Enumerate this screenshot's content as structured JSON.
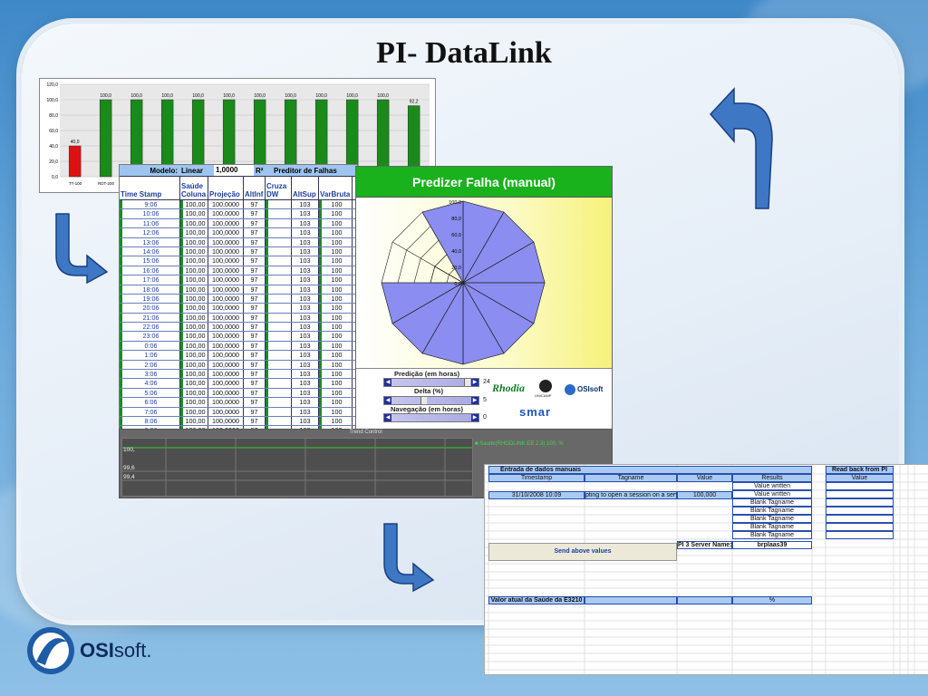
{
  "slide": {
    "title": "PI- DataLink"
  },
  "bar_chart": {
    "y_ticks": [
      "0,0",
      "20,0",
      "40,0",
      "60,0",
      "80,0",
      "100,0",
      "120,0"
    ],
    "bars": [
      {
        "label": "40,0",
        "value": 40,
        "color": "#d11"
      },
      {
        "label": "100,0",
        "value": 100,
        "color": "#1a8a1a"
      },
      {
        "label": "100,0",
        "value": 100,
        "color": "#1a8a1a"
      },
      {
        "label": "100,0",
        "value": 100,
        "color": "#1a8a1a"
      },
      {
        "label": "100,0",
        "value": 100,
        "color": "#1a8a1a"
      },
      {
        "label": "100,0",
        "value": 100,
        "color": "#1a8a1a"
      },
      {
        "label": "100,0",
        "value": 100,
        "color": "#1a8a1a"
      },
      {
        "label": "100,0",
        "value": 100,
        "color": "#1a8a1a"
      },
      {
        "label": "100,0",
        "value": 100,
        "color": "#1a8a1a"
      },
      {
        "label": "100,0",
        "value": 100,
        "color": "#1a8a1a"
      },
      {
        "label": "100,0",
        "value": 100,
        "color": "#1a8a1a"
      },
      {
        "label": "92,2",
        "value": 92.2,
        "color": "#1a8a1a"
      }
    ],
    "categories": [
      "TT-100",
      "RDT-200"
    ]
  },
  "sheet": {
    "model_label": "Modelo:",
    "model_value": "Linear",
    "coef": "1,0000",
    "r2": "R²",
    "title": "Preditor de Falhas",
    "headers": {
      "timestamp": "Time Stamp",
      "saude": "Saúde Coluna",
      "projecao": "Projeção",
      "altinf": "AltInf",
      "cruzadw": "Cruza DW",
      "altsup": "AltSup",
      "varbruta": "VarBruta"
    },
    "rows": [
      [
        "9:06",
        "100,00",
        "100,0000",
        "97",
        "",
        "103",
        "100"
      ],
      [
        "10:06",
        "100,00",
        "100,0000",
        "97",
        "",
        "103",
        "100"
      ],
      [
        "11:06",
        "100,00",
        "100,0000",
        "97",
        "",
        "103",
        "100"
      ],
      [
        "12:06",
        "100,00",
        "100,0000",
        "97",
        "",
        "103",
        "100"
      ],
      [
        "13:06",
        "100,00",
        "100,0000",
        "97",
        "",
        "103",
        "100"
      ],
      [
        "14:06",
        "100,00",
        "100,0000",
        "97",
        "",
        "103",
        "100"
      ],
      [
        "15:06",
        "100,00",
        "100,0000",
        "97",
        "",
        "103",
        "100"
      ],
      [
        "16:06",
        "100,00",
        "100,0000",
        "97",
        "",
        "103",
        "100"
      ],
      [
        "17:06",
        "100,00",
        "100,0000",
        "97",
        "",
        "103",
        "100"
      ],
      [
        "18:06",
        "100,00",
        "100,0000",
        "97",
        "",
        "103",
        "100"
      ],
      [
        "19:06",
        "100,00",
        "100,0000",
        "97",
        "",
        "103",
        "100"
      ],
      [
        "20:06",
        "100,00",
        "100,0000",
        "97",
        "",
        "103",
        "100"
      ],
      [
        "21:06",
        "100,00",
        "100,0000",
        "97",
        "",
        "103",
        "100"
      ],
      [
        "22:06",
        "100,00",
        "100,0000",
        "97",
        "",
        "103",
        "100"
      ],
      [
        "23:06",
        "100,00",
        "100,0000",
        "97",
        "",
        "103",
        "100"
      ],
      [
        "0:06",
        "100,00",
        "100,0000",
        "97",
        "",
        "103",
        "100"
      ],
      [
        "1:06",
        "100,00",
        "100,0000",
        "97",
        "",
        "103",
        "100"
      ],
      [
        "2:06",
        "100,00",
        "100,0000",
        "97",
        "",
        "103",
        "100"
      ],
      [
        "3:06",
        "100,00",
        "100,0000",
        "97",
        "",
        "103",
        "100"
      ],
      [
        "4:06",
        "100,00",
        "100,0000",
        "97",
        "",
        "103",
        "100"
      ],
      [
        "5:06",
        "100,00",
        "100,0000",
        "97",
        "",
        "103",
        "100"
      ],
      [
        "6:06",
        "100,00",
        "100,0000",
        "97",
        "",
        "103",
        "100"
      ],
      [
        "7:06",
        "100,00",
        "100,0000",
        "97",
        "",
        "103",
        "100"
      ],
      [
        "8:06",
        "100,00",
        "100,0000",
        "97",
        "",
        "103",
        "100"
      ],
      [
        "9:06",
        "100,00",
        "100,0000",
        "97",
        "",
        "103",
        "100"
      ],
      [
        "10:06",
        "100,00",
        "100,0000",
        "97",
        "",
        "103",
        "100"
      ],
      [
        "11:06",
        "100,00",
        "100,0000",
        "97",
        "",
        "103",
        "100"
      ]
    ]
  },
  "pie": {
    "title": "Predizer Falha (manual)",
    "ring_labels": [
      "100,0",
      "80,0",
      "60,0",
      "40,0",
      "20,0",
      "0,0"
    ],
    "slices": 12,
    "values": [
      100,
      100,
      100,
      100,
      100,
      100,
      100,
      100,
      100,
      40,
      40,
      100
    ],
    "controls": {
      "predicao_label": "Predição (em horas)",
      "predicao_value": "24",
      "delta_label": "Delta (%)",
      "delta_value": "5",
      "navegacao_label": "Navegação (em horas)",
      "navegacao_value": "0"
    },
    "logos": {
      "rhodia": "Rhodia",
      "smar": "smar",
      "unicamp": "UNICAMP",
      "osisoft": "OSIsoft"
    }
  },
  "trend": {
    "title": "Trend Control",
    "y_labels": [
      "100,",
      "99,6",
      "99,4"
    ],
    "legend": "■ Saude(RHODLINK.EE 2.3) 100, %"
  },
  "entry": {
    "section_title": "Entrada de dados manuais",
    "headers": {
      "timestamp": "Timestamp",
      "tagname": "Tagname",
      "value": "Value",
      "results": "Results"
    },
    "readback_title": "Read back from PI",
    "readback_value_hdr": "Value",
    "row1": {
      "timestamp": "31/10/2008 10:09",
      "tagname": "pting to open a session on a serv",
      "value": "100,000"
    },
    "results": [
      "Value written",
      "Value written",
      "Blank Tagname",
      "Blank Tagname",
      "Blank Tagname",
      "Blank Tagname",
      "Blank Tagname"
    ],
    "server_label": "PI 3 Server Name:",
    "server_value": "brplaas39",
    "send_button": "Send above values",
    "current_label": "Valor atual da Saúde da E3210",
    "current_unit": "%"
  },
  "brand": {
    "osi": "OSI",
    "soft": "soft."
  }
}
